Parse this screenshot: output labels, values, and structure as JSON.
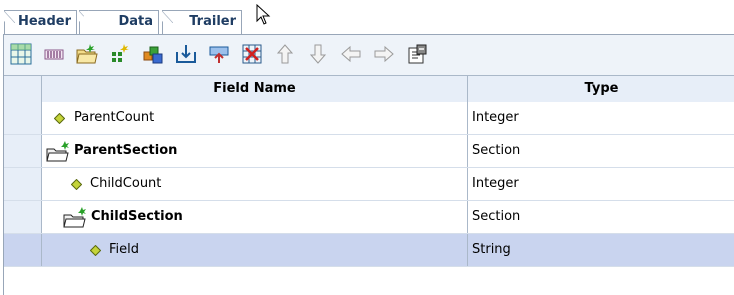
{
  "tabs": [
    {
      "label": "Header",
      "active": false
    },
    {
      "label": "Data",
      "active": true
    },
    {
      "label": "Trailer",
      "active": false
    }
  ],
  "toolbar": {
    "icons": [
      "table-icon",
      "columns-icon",
      "new-folder-icon",
      "add-field-icon",
      "add-component-icon",
      "import-icon",
      "export-icon",
      "delete-icon",
      "move-up-icon",
      "move-down-icon",
      "move-left-icon",
      "move-right-icon",
      "properties-icon"
    ]
  },
  "grid": {
    "columns": {
      "field_name": "Field Name",
      "type": "Type"
    },
    "rows": [
      {
        "name": "ParentCount",
        "type": "Integer",
        "kind": "field",
        "level": 0
      },
      {
        "name": "ParentSection",
        "type": "Section",
        "kind": "section",
        "level": 0
      },
      {
        "name": "ChildCount",
        "type": "Integer",
        "kind": "field",
        "level": 1
      },
      {
        "name": "ChildSection",
        "type": "Section",
        "kind": "section",
        "level": 1
      },
      {
        "name": "Field",
        "type": "String",
        "kind": "field",
        "level": 2
      }
    ],
    "selected_row": 4
  },
  "colors": {
    "tab_text": "#1f3d63",
    "header_bg": "#e7eef8",
    "selected_bg": "#c9d4ef",
    "field_diamond": "#b8c93c",
    "section_star": "#2aa12a"
  }
}
